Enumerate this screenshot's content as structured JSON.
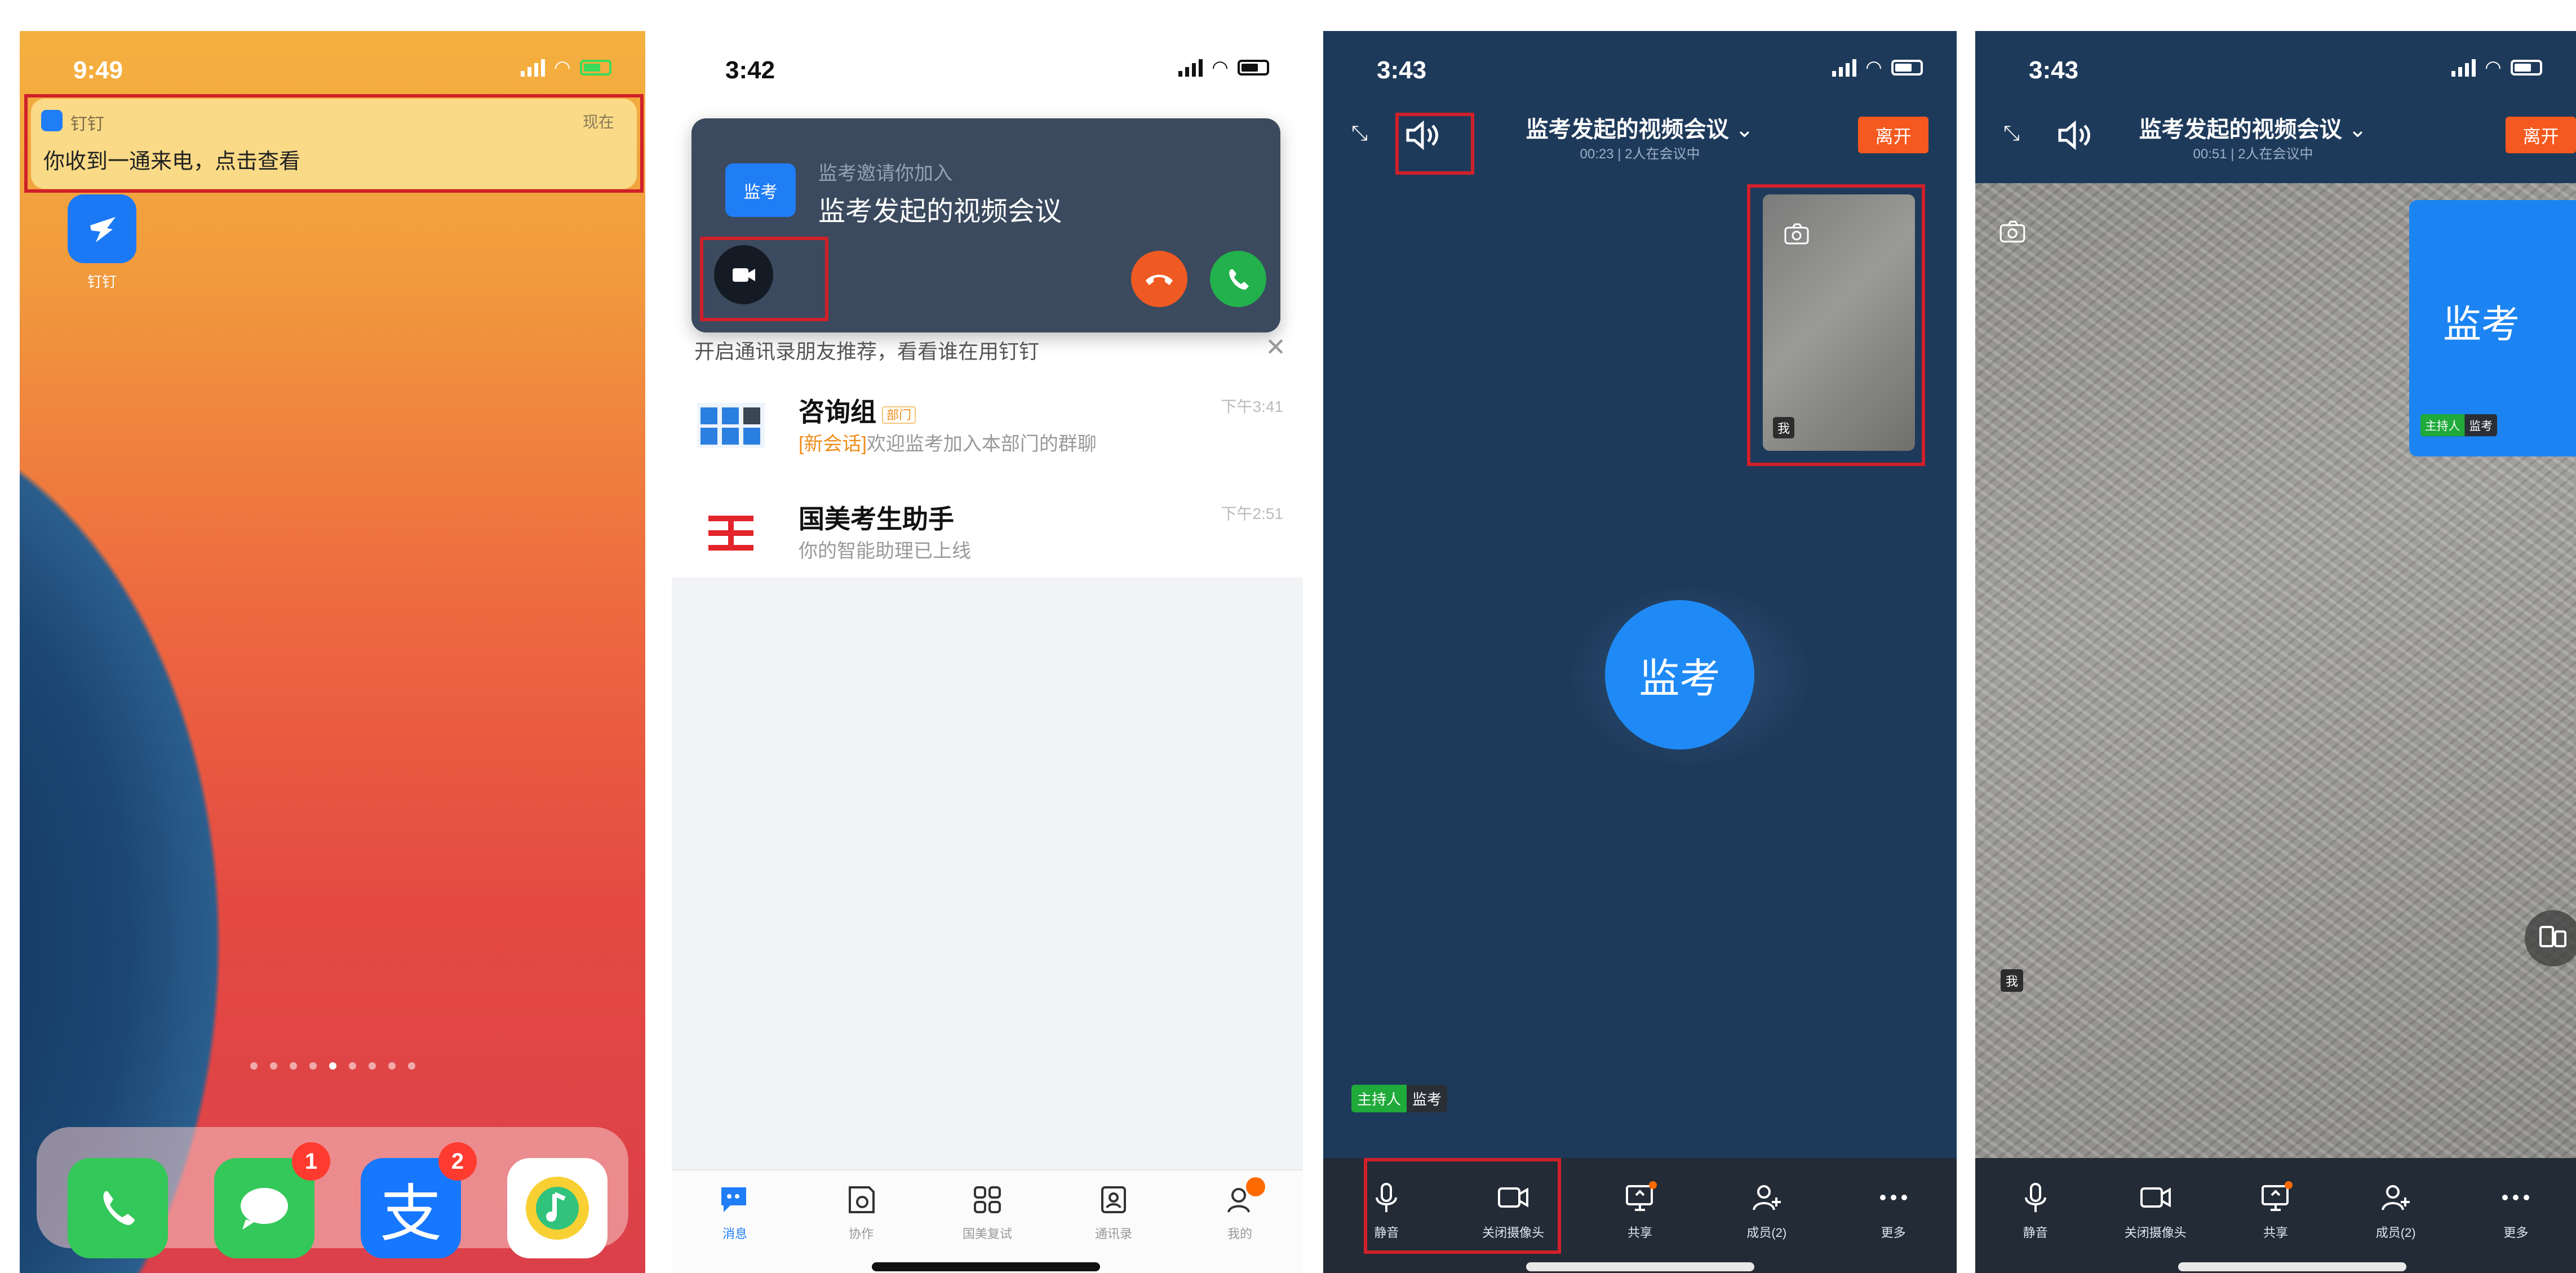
{
  "panel1": {
    "status_time": "9:49",
    "notification": {
      "app": "钉钉",
      "time": "现在",
      "message": "你收到一通来电，点击查看"
    },
    "home_app_label": "钉钉",
    "dock": [
      {
        "name": "phone",
        "badge": ""
      },
      {
        "name": "messages",
        "badge": "1"
      },
      {
        "name": "alipay",
        "badge": "2"
      },
      {
        "name": "qq-music",
        "badge": ""
      }
    ]
  },
  "panel2": {
    "status_time": "3:42",
    "call": {
      "caller_avatar": "监考",
      "subtitle": "监考邀请你加入",
      "title": "监考发起的视频会议"
    },
    "hint": "开启通讯录朋友推荐，看看谁在用钉钉",
    "chats": [
      {
        "name": "咨询组",
        "tag": "部门",
        "preview_highlight": "[新会话]",
        "preview": "欢迎监考加入本部门的群聊",
        "time": "下午3:41"
      },
      {
        "name": "国美考生助手",
        "tag": "",
        "preview_highlight": "",
        "preview": "你的智能助理已上线",
        "time": "下午2:51"
      }
    ],
    "tabs": [
      "消息",
      "协作",
      "国美复试",
      "通讯录",
      "我的"
    ]
  },
  "panel3": {
    "status_time": "3:43",
    "title": "监考发起的视频会议",
    "subtitle": "00:23 | 2人在会议中",
    "leave": "离开",
    "self_label": "我",
    "avatar_name": "监考",
    "host_tag": "主持人",
    "host_name": "监考",
    "tools": [
      "静音",
      "关闭摄像头",
      "共享",
      "成员(2)",
      "更多"
    ]
  },
  "panel4": {
    "status_time": "3:43",
    "title": "监考发起的视频会议",
    "subtitle": "00:51 | 2人在会议中",
    "leave": "离开",
    "self_label": "我",
    "remote_name": "监考",
    "host_tag": "主持人",
    "host_name": "监考",
    "tools": [
      "静音",
      "关闭摄像头",
      "共享",
      "成员(2)",
      "更多"
    ]
  },
  "colors": {
    "highlight": "#d0202a",
    "dingtalk_blue": "#1f7df6",
    "leave_orange": "#f5591f",
    "host_green": "#1faa3a"
  }
}
